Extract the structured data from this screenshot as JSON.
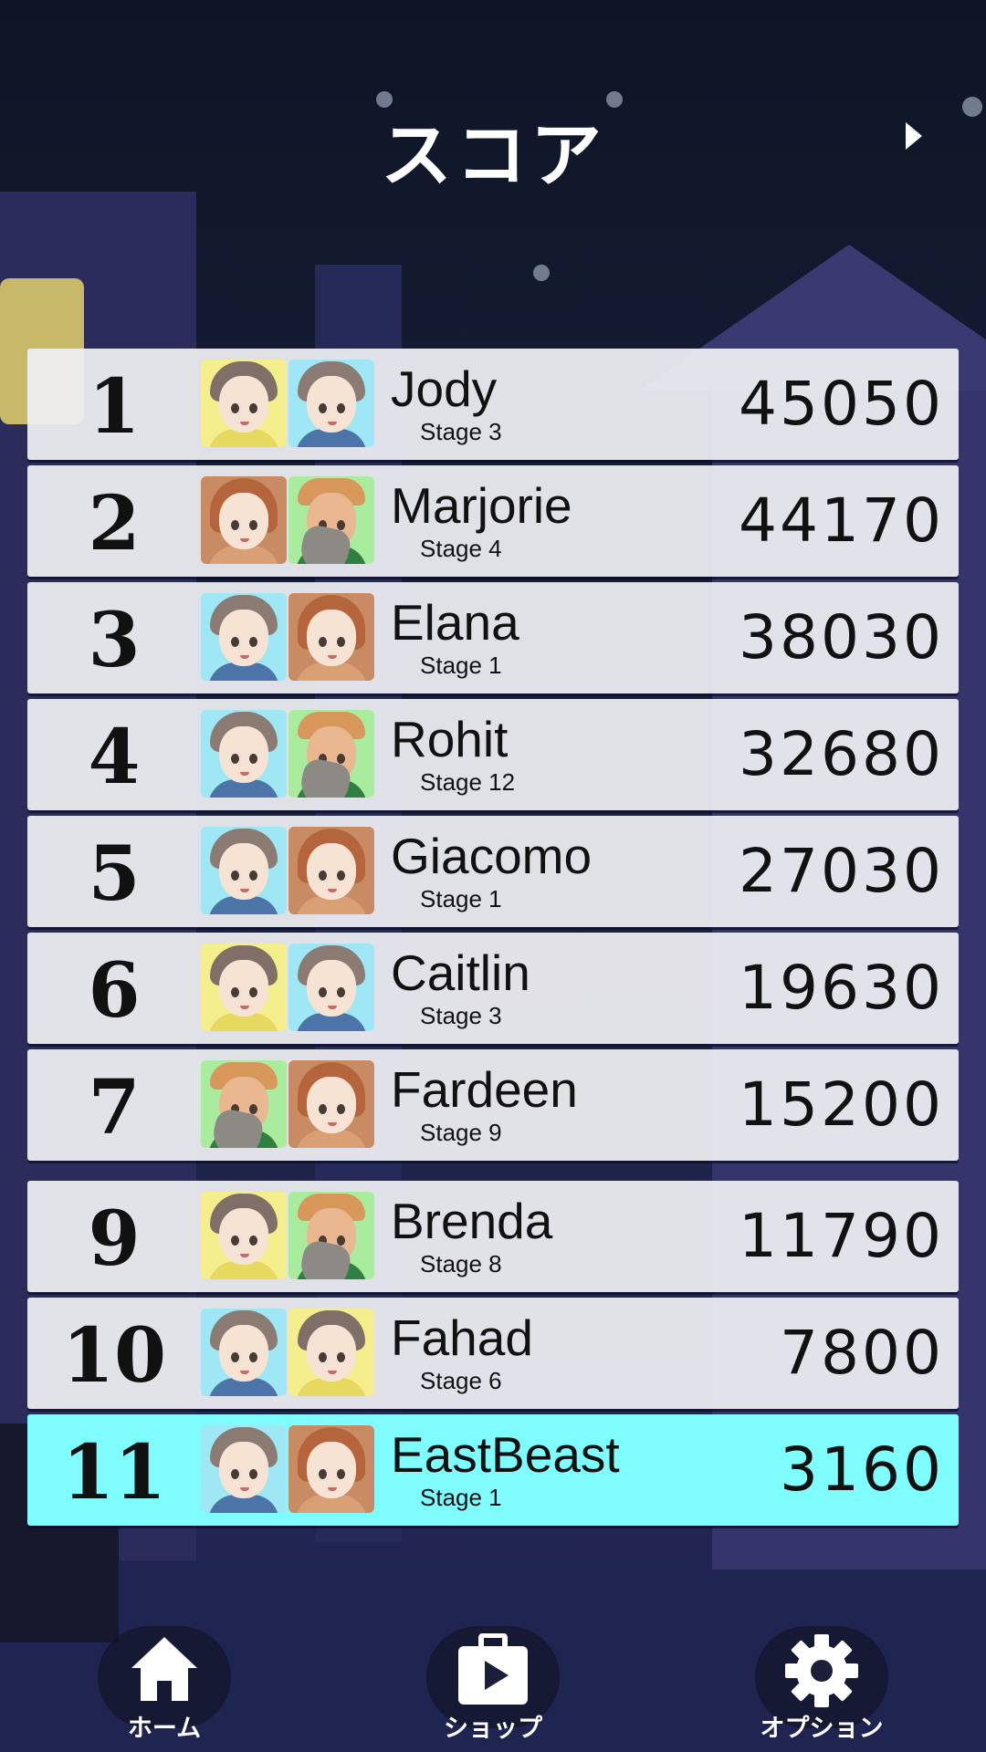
{
  "screen": {
    "title": "スコア",
    "next_icon": "play-arrow-icon"
  },
  "scores": [
    {
      "rank": "1",
      "name": "Jody",
      "stage": "Stage 3",
      "score": "45050",
      "avatars": [
        "girl",
        "boy"
      ],
      "current": false
    },
    {
      "rank": "2",
      "name": "Marjorie",
      "stage": "Stage 4",
      "score": "44170",
      "avatars": [
        "auburn",
        "sage"
      ],
      "current": false
    },
    {
      "rank": "3",
      "name": "Elana",
      "stage": "Stage 1",
      "score": "38030",
      "avatars": [
        "boy",
        "auburn"
      ],
      "current": false
    },
    {
      "rank": "4",
      "name": "Rohit",
      "stage": "Stage 12",
      "score": "32680",
      "avatars": [
        "boy",
        "sage"
      ],
      "current": false
    },
    {
      "rank": "5",
      "name": "Giacomo",
      "stage": "Stage 1",
      "score": "27030",
      "avatars": [
        "boy",
        "auburn"
      ],
      "current": false
    },
    {
      "rank": "6",
      "name": "Caitlin",
      "stage": "Stage 3",
      "score": "19630",
      "avatars": [
        "girl",
        "boy"
      ],
      "current": false
    },
    {
      "rank": "7",
      "name": "Fardeen",
      "stage": "Stage 9",
      "score": "15200",
      "avatars": [
        "sage",
        "auburn"
      ],
      "current": false
    },
    {
      "rank": "9",
      "name": "Brenda",
      "stage": "Stage 8",
      "score": "11790",
      "avatars": [
        "girl",
        "sage"
      ],
      "current": false
    },
    {
      "rank": "10",
      "name": "Fahad",
      "stage": "Stage 6",
      "score": "7800",
      "avatars": [
        "boy",
        "girl"
      ],
      "current": false
    },
    {
      "rank": "11",
      "name": "EastBeast",
      "stage": "Stage 1",
      "score": "3160",
      "avatars": [
        "boy",
        "auburn"
      ],
      "current": true
    }
  ],
  "nav": {
    "home": {
      "label": "ホーム",
      "icon": "home-icon"
    },
    "shop": {
      "label": "ショップ",
      "icon": "shop-play-icon"
    },
    "options": {
      "label": "オプション",
      "icon": "gear-icon"
    }
  },
  "colors": {
    "current_row": "#7ffdfe",
    "row": "#f0f0f4",
    "background": "#151c33"
  }
}
